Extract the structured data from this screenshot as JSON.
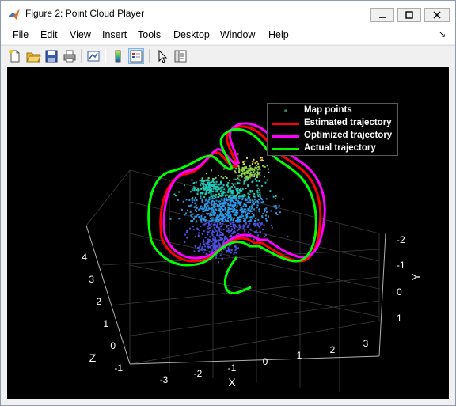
{
  "window": {
    "title": "Figure 2: Point Cloud Player"
  },
  "menu": {
    "items": [
      {
        "label": "File"
      },
      {
        "label": "Edit"
      },
      {
        "label": "View"
      },
      {
        "label": "Insert"
      },
      {
        "label": "Tools"
      },
      {
        "label": "Desktop"
      },
      {
        "label": "Window"
      },
      {
        "label": "Help"
      }
    ],
    "overflow_glyph": "↘"
  },
  "toolbar": {
    "buttons": [
      {
        "icon": "new-figure-icon"
      },
      {
        "icon": "open-file-icon"
      },
      {
        "icon": "save-icon"
      },
      {
        "icon": "print-icon"
      },
      {
        "icon": "link-plot-icon"
      },
      {
        "icon": "colorbar-icon"
      },
      {
        "icon": "legend-icon"
      },
      {
        "icon": "pointer-icon"
      },
      {
        "icon": "property-editor-icon"
      }
    ]
  },
  "plot": {
    "xlabel": "X",
    "ylabel": "Y",
    "zlabel": "Z",
    "x_ticks": [
      "-3",
      "-2",
      "-1",
      "0",
      "1",
      "2",
      "3"
    ],
    "y_ticks": [
      "-2",
      "-1",
      "0",
      "1"
    ],
    "z_ticks": [
      "-1",
      "0",
      "1",
      "2",
      "3",
      "4"
    ],
    "legend": {
      "placement": "top-right",
      "entries": [
        {
          "label": "Map points",
          "color": "#2a8f5a",
          "type": "marker"
        },
        {
          "label": "Estimated trajectory",
          "color": "#ff0000",
          "type": "line"
        },
        {
          "label": "Optimized trajectory",
          "color": "#ff00ff",
          "type": "line"
        },
        {
          "label": "Actual trajectory",
          "color": "#00ff00",
          "type": "line"
        }
      ]
    }
  }
}
